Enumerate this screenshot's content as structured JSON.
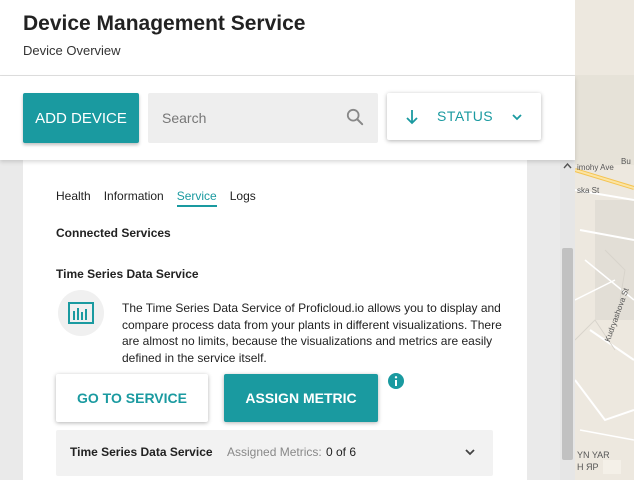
{
  "header": {
    "title": "Device Management Service",
    "subtitle": "Device Overview"
  },
  "toolbar": {
    "add_label": "ADD DEVICE",
    "search_placeholder": "Search",
    "status_label": "STATUS"
  },
  "tabs": [
    {
      "label": "Health",
      "active": false
    },
    {
      "label": "Information",
      "active": false
    },
    {
      "label": "Service",
      "active": true
    },
    {
      "label": "Logs",
      "active": false
    }
  ],
  "content": {
    "section_title": "Connected Services",
    "service_title": "Time Series Data Service",
    "service_icon": "chart-bars-icon",
    "description": "The Time Series Data Service of Proficloud.io allows you to display and compare process data from your plants in different visualizations. There are almost no limits, because the visualizations and metrics are easily defined in the service itself.",
    "goto_label": "GO TO SERVICE",
    "assign_label": "ASSIGN METRIC"
  },
  "metric_row": {
    "name": "Time Series Data Service",
    "label": "Assigned Metrics:",
    "value": "0 of 6"
  },
  "map": {
    "labels": [
      "imohy Ave",
      "Bu",
      "ska St",
      "Kudryashova St",
      "YN YAR",
      "Н ЯР"
    ]
  },
  "colors": {
    "accent": "#1a9aa0",
    "map_bg": "#ede8df",
    "panel_bg": "#eaeaea"
  }
}
